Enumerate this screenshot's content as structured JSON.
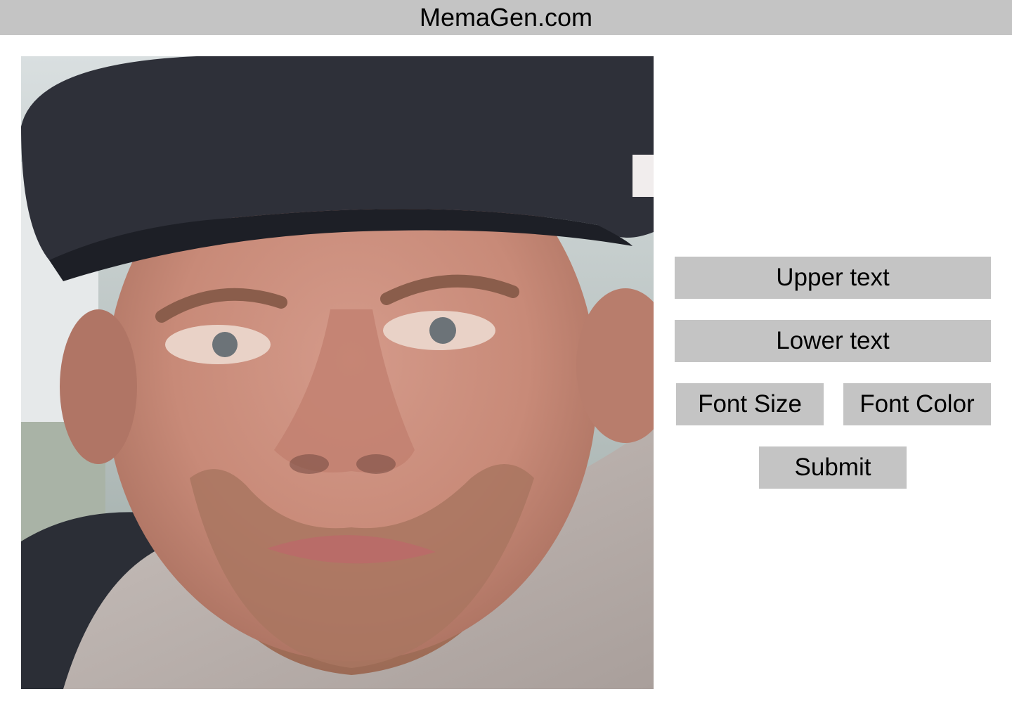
{
  "header": {
    "title": "MemaGen.com"
  },
  "editor": {
    "upper_text_label": "Upper text",
    "lower_text_label": "Lower text",
    "font_size_label": "Font Size",
    "font_color_label": "Font Color",
    "submit_label": "Submit"
  },
  "colors": {
    "header_bg": "#c4c4c4",
    "button_bg": "#c4c4c4",
    "page_bg": "#ffffff",
    "text": "#000000"
  },
  "image": {
    "subject": "photo of a man wearing a black flat cap"
  }
}
